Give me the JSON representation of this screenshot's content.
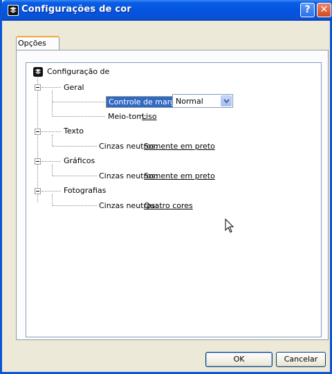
{
  "window": {
    "title": "Configurações de cor",
    "help_label": "?",
    "close_label": "✕"
  },
  "tabs": [
    {
      "label": "Opções"
    }
  ],
  "tree": {
    "root": "Configuração de",
    "geral": {
      "label": "Geral",
      "controle_label": "Controle de margem:",
      "controle_value": "Normal",
      "meiotom_label": "Meio-tom:",
      "meiotom_value": "Liso"
    },
    "texto": {
      "label": "Texto",
      "cinzas_label": "Cinzas neutros:",
      "cinzas_value": "Somente em preto"
    },
    "graficos": {
      "label": "Gráficos",
      "cinzas_label": "Cinzas neutros:",
      "cinzas_value": "Somente em preto"
    },
    "fotografias": {
      "label": "Fotografias",
      "cinzas_label": "Cinzas neutros:",
      "cinzas_value": "Quatro cores"
    }
  },
  "buttons": {
    "ok": "OK",
    "cancel": "Cancelar"
  },
  "colors": {
    "title_bar": "#0454e0",
    "selection": "#316ac5",
    "tab_highlight": "#f5a631"
  }
}
